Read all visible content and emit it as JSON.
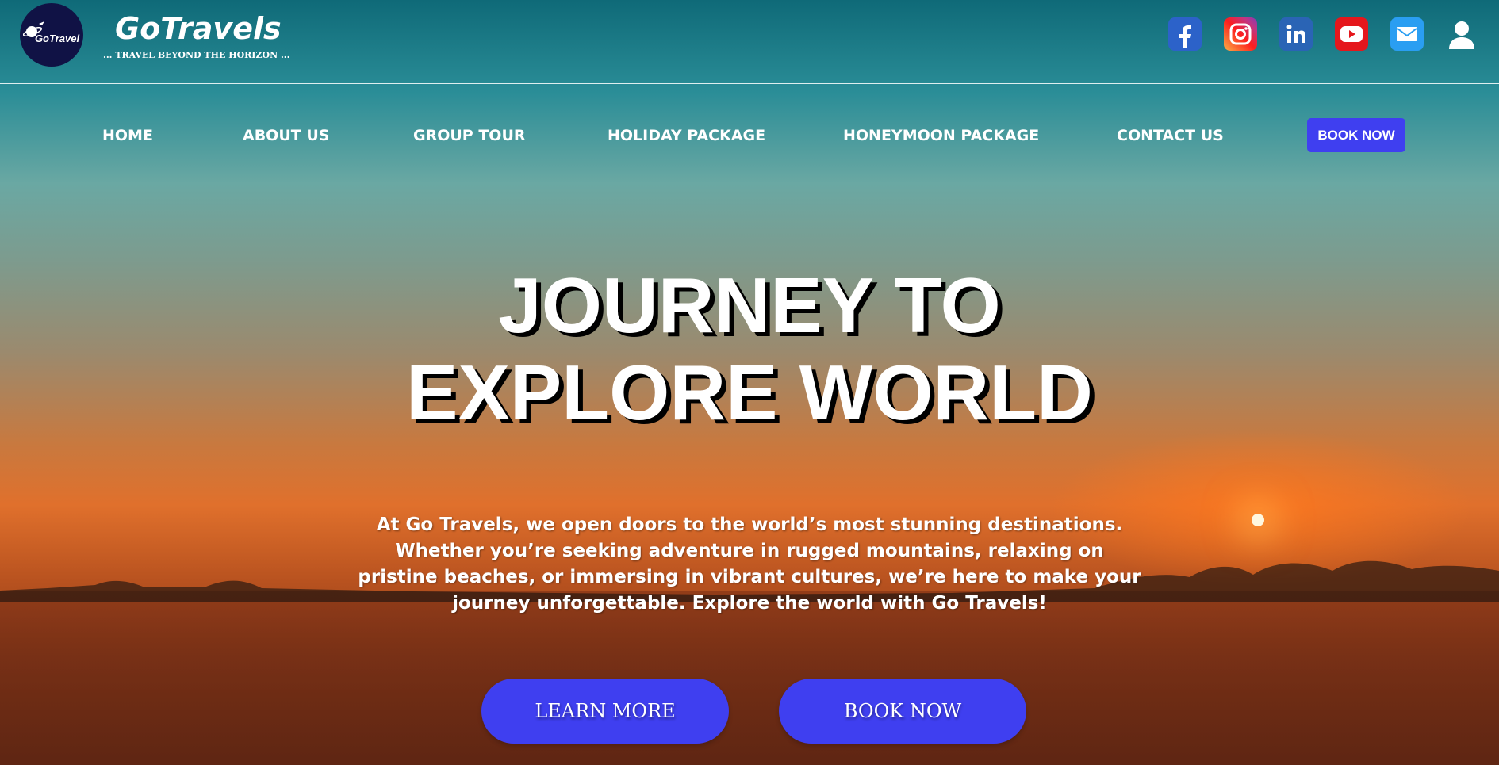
{
  "brand": {
    "logo_text": "GoTravel",
    "name": "GoTravels",
    "tagline": "... TRAVEL BEYOND THE HORIZON ..."
  },
  "social_icons": [
    "facebook-icon",
    "instagram-icon",
    "linkedin-icon",
    "youtube-icon",
    "mail-icon",
    "user-icon"
  ],
  "nav": {
    "items": [
      "HOME",
      "ABOUT US",
      "GROUP TOUR",
      "HOLIDAY PACKAGE",
      "HONEYMOON PACKAGE",
      "CONTACT US"
    ],
    "book_label": "BOOK NOW"
  },
  "hero": {
    "title_line1": "JOURNEY TO",
    "title_line2": "EXPLORE WORLD",
    "description": "At Go Travels, we open doors to the world’s most stunning destinations. Whether you’re seeking adventure in rugged mountains, relaxing on pristine beaches, or immersing in vibrant cultures, we’re here to make your journey unforgettable. Explore the world with Go Travels!",
    "learn_more_label": "LEARN MORE",
    "book_now_label": "BOOK NOW"
  },
  "colors": {
    "accent": "#3f3ff0",
    "logo_bg": "#101245"
  }
}
